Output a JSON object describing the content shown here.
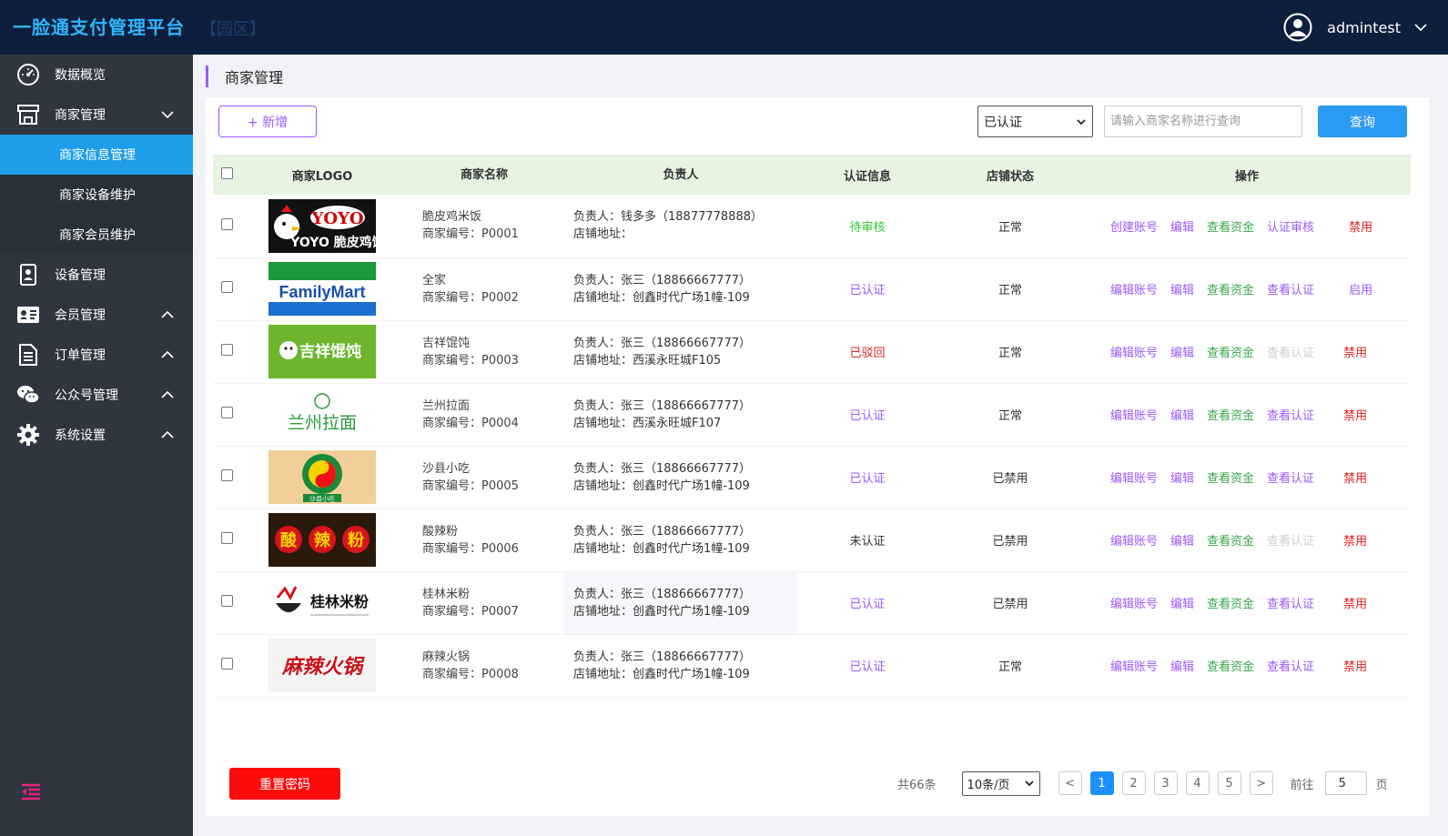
{
  "header": {
    "brand": "一脸通支付管理平台",
    "zone": "【园区】",
    "username": "admintest"
  },
  "sidebar": {
    "items": [
      {
        "label": "数据概览",
        "icon": "dashboard-icon"
      },
      {
        "label": "商家管理",
        "icon": "store-icon"
      },
      {
        "label": "设备管理",
        "icon": "device-icon"
      },
      {
        "label": "会员管理",
        "icon": "member-card-icon"
      },
      {
        "label": "订单管理",
        "icon": "order-doc-icon"
      },
      {
        "label": "公众号管理",
        "icon": "wechat-icon"
      },
      {
        "label": "系统设置",
        "icon": "gear-icon"
      }
    ],
    "sub_items": [
      {
        "label": "商家信息管理"
      },
      {
        "label": "商家设备维护"
      },
      {
        "label": "商家会员维护"
      }
    ]
  },
  "page": {
    "title": "商家管理"
  },
  "toolbar": {
    "add_label": "+ 新增",
    "status_value": "已认证",
    "search_placeholder": "请输入商家名称进行查询",
    "query_label": "查询"
  },
  "table": {
    "headers": [
      "商家LOGO",
      "商家名称",
      "负责人",
      "认证信息",
      "店铺状态",
      "操作"
    ],
    "rows": [
      {
        "name": "脆皮鸡米饭",
        "code": "商家编号：P0001",
        "owner": "负责人：钱多多（18877778888）",
        "addr": "店铺地址：",
        "auth": "待审核",
        "store": "正常",
        "ops": [
          "创建账号",
          "编辑",
          "查看资金",
          "认证审核"
        ],
        "action": "禁用",
        "logo_text": "YOYO 脆皮鸡饭"
      },
      {
        "name": "全家",
        "code": "商家编号：P0002",
        "owner": "负责人：张三（18866667777）",
        "addr": "店铺地址：创鑫时代广场1幢-109",
        "auth": "已认证",
        "store": "正常",
        "ops": [
          "编辑账号",
          "编辑",
          "查看资金",
          "查看认证"
        ],
        "action": "启用",
        "logo_text": "FamilyMart"
      },
      {
        "name": "吉祥馄饨",
        "code": "商家编号：P0003",
        "owner": "负责人：张三（18866667777）",
        "addr": "店铺地址：西溪永旺城F105",
        "auth": "已驳回",
        "store": "正常",
        "ops": [
          "编辑账号",
          "编辑",
          "查看资金",
          "查看认证"
        ],
        "action": "禁用",
        "logo_text": "吉祥馄饨"
      },
      {
        "name": "兰州拉面",
        "code": "商家编号：P0004",
        "owner": "负责人：张三（18866667777）",
        "addr": "店铺地址：西溪永旺城F107",
        "auth": "已认证",
        "store": "正常",
        "ops": [
          "编辑账号",
          "编辑",
          "查看资金",
          "查看认证"
        ],
        "action": "禁用",
        "logo_text": "兰州拉面"
      },
      {
        "name": "沙县小吃",
        "code": "商家编号：P0005",
        "owner": "负责人：张三（18866667777）",
        "addr": "店铺地址：创鑫时代广场1幢-109",
        "auth": "已认证",
        "store": "已禁用",
        "ops": [
          "编辑账号",
          "编辑",
          "查看资金",
          "查看认证"
        ],
        "action": "禁用",
        "logo_text": "沙县小吃"
      },
      {
        "name": "酸辣粉",
        "code": "商家编号：P0006",
        "owner": "负责人：张三（18866667777）",
        "addr": "店铺地址：创鑫时代广场1幢-109",
        "auth": "未认证",
        "store": "已禁用",
        "ops": [
          "编辑账号",
          "编辑",
          "查看资金",
          "查看认证"
        ],
        "action": "禁用",
        "logo_text": "酸辣粉"
      },
      {
        "name": "桂林米粉",
        "code": "商家编号：P0007",
        "owner": "负责人：张三（18866667777）",
        "addr": "店铺地址：创鑫时代广场1幢-109",
        "auth": "已认证",
        "store": "已禁用",
        "ops": [
          "编辑账号",
          "编辑",
          "查看资金",
          "查看认证"
        ],
        "action": "禁用",
        "logo_text": "桂林米粉"
      },
      {
        "name": "麻辣火锅",
        "code": "商家编号：P0008",
        "owner": "负责人：张三（18866667777）",
        "addr": "店铺地址：创鑫时代广场1幢-109",
        "auth": "已认证",
        "store": "正常",
        "ops": [
          "编辑账号",
          "编辑",
          "查看资金",
          "查看认证"
        ],
        "action": "禁用",
        "logo_text": "麻辣火锅"
      }
    ]
  },
  "footer": {
    "reset_label": "重置密码",
    "total": "共66条",
    "page_size": "10条/页",
    "pages": [
      "1",
      "2",
      "3",
      "4",
      "5"
    ],
    "prev": "<",
    "next": ">",
    "goto_label": "前往",
    "goto_value": "5",
    "page_unit": "页"
  },
  "colors": {
    "header_bg": "#0d1f3c",
    "sidebar_bg": "#2f3640",
    "active_blue": "#1e9ee8",
    "accent_purple": "#9b59f6",
    "table_header_bg": "#e6f4e0",
    "danger_red": "#ff0a0a"
  }
}
